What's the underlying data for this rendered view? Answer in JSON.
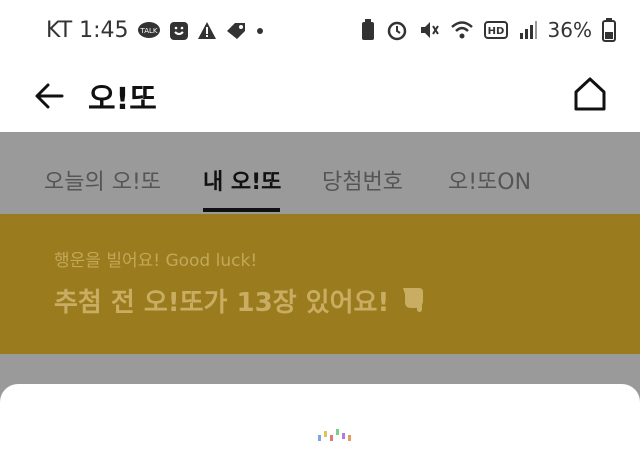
{
  "status_bar": {
    "carrier_time": "KT 1:45",
    "notification_icons": [
      "talk-icon",
      "smile-icon",
      "warning-icon",
      "tag-icon",
      "dot-icon"
    ],
    "system_icons": [
      "battery-saver-icon",
      "alarm-icon",
      "mute-icon",
      "wifi-icon",
      "hd-icon",
      "signal-icon"
    ],
    "battery": "36%"
  },
  "header": {
    "title": "오!또"
  },
  "tabs": [
    {
      "label": "오늘의 오!또",
      "active": false
    },
    {
      "label": "내 오!또",
      "active": true
    },
    {
      "label": "당첨번호",
      "active": false
    },
    {
      "label": "오!또ON",
      "active": false
    }
  ],
  "banner": {
    "subtitle": "행운을 빌어요! Good luck!",
    "message": "추첨 전 오!또가 13장 있어요!",
    "icon": "pointing-hand-icon"
  },
  "colors": {
    "overlay": "#9a9a9a",
    "banner_bg": "#9a7b1e",
    "banner_text": "#c9ad63"
  }
}
